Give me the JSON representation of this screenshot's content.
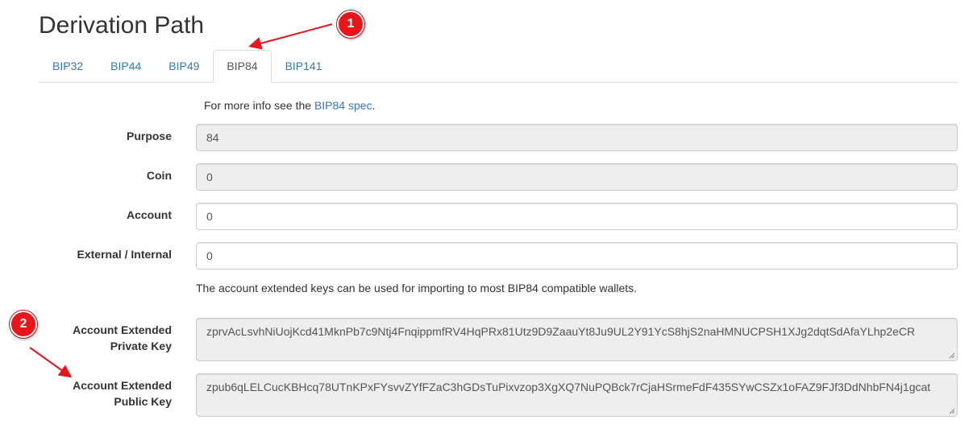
{
  "page_title": "Derivation Path",
  "tabs": [
    {
      "label": "BIP32",
      "active": false
    },
    {
      "label": "BIP44",
      "active": false
    },
    {
      "label": "BIP49",
      "active": false
    },
    {
      "label": "BIP84",
      "active": true
    },
    {
      "label": "BIP141",
      "active": false
    }
  ],
  "info": {
    "prefix": "For more info see the ",
    "link": "BIP84 spec",
    "suffix": "."
  },
  "fields": {
    "purpose": {
      "label": "Purpose",
      "value": "84"
    },
    "coin": {
      "label": "Coin",
      "value": "0"
    },
    "account": {
      "label": "Account",
      "value": "0"
    },
    "external_internal": {
      "label_a": "External",
      "sep": " / ",
      "label_b": "Internal",
      "value": "0"
    }
  },
  "note": "The account extended keys can be used for importing to most BIP84 compatible wallets.",
  "keys": {
    "private": {
      "label_line1": "Account Extended",
      "label_line2": "Private Key",
      "value": "zprvAcLsvhNiUojKcd41MknPb7c9Ntj4FnqippmfRV4HqPRx81Utz9D9ZaauYt8Ju9UL2Y91YcS8hjS2naHMNUCPSH1XJg2dqtSdAfaYLhp2eCR"
    },
    "public": {
      "label_line1": "Account Extended",
      "label_line2": "Public Key",
      "value": "zpub6qLELCucKBHcq78UTnKPxFYsvvZYfFZaC3hGDsTuPixvzop3XgXQ7NuPQBck7rCjaHSrmeFdF435SYwCSZx1oFAZ9FJf3DdNhbFN4j1gcat"
    }
  },
  "annotations": [
    {
      "number": "1",
      "color": "#e8161b"
    },
    {
      "number": "2",
      "color": "#e8161b"
    }
  ]
}
